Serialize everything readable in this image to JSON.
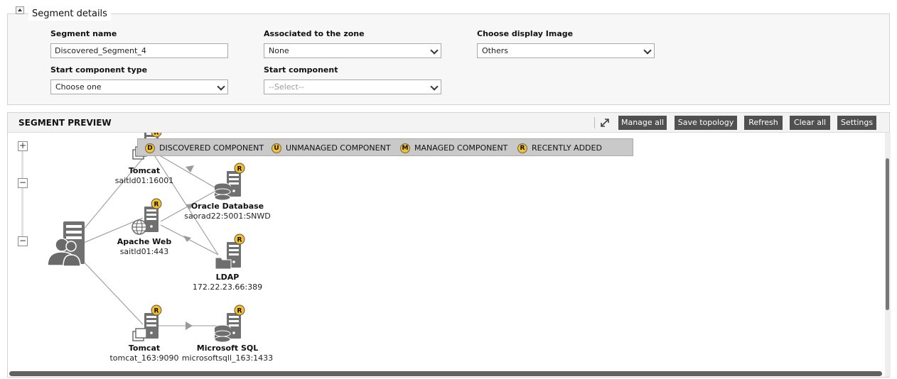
{
  "segment_details": {
    "title": "Segment details",
    "segment_name": {
      "label": "Segment name",
      "value": "Discovered_Segment_4"
    },
    "associated_zone": {
      "label": "Associated to the zone",
      "value": "None"
    },
    "display_image": {
      "label": "Choose display Image",
      "value": "Others"
    },
    "start_component_type": {
      "label": "Start component type",
      "value": "Choose one"
    },
    "start_component": {
      "label": "Start component",
      "value": "--Select--"
    }
  },
  "preview": {
    "title": "SEGMENT PREVIEW",
    "buttons": [
      "Manage all",
      "Save topology",
      "Refresh",
      "Clear all",
      "Settings"
    ],
    "legend": [
      {
        "badge": "D",
        "label": "DISCOVERED COMPONENT"
      },
      {
        "badge": "U",
        "label": "UNMANAGED COMPONENT"
      },
      {
        "badge": "M",
        "label": "MANAGED COMPONENT"
      },
      {
        "badge": "R",
        "label": "RECENTLY ADDED"
      }
    ],
    "zoom": {
      "in": "+",
      "mid": "−",
      "out": "−"
    },
    "nodes": [
      {
        "name": "Tomcat",
        "address": "saitld01:16001",
        "badge": "R"
      },
      {
        "name": "Oracle Database",
        "address": "saorad22:5001:SNWD",
        "badge": "R"
      },
      {
        "name": "Apache Web",
        "address": "saitld01:443",
        "badge": "R"
      },
      {
        "name": "LDAP",
        "address": "172.22.23.66:389",
        "badge": "R"
      },
      {
        "name": "Tomcat",
        "address": "tomcat_163:9090",
        "badge": "R"
      },
      {
        "name": "Microsoft SQL",
        "address": "microsoftsqll_163:1433",
        "badge": "R"
      }
    ]
  },
  "colors": {
    "button_bg": "#505050",
    "badge": "#f5c028",
    "legend_bg": "#c9c9c9",
    "icon_gray": "#6e6e6e"
  }
}
